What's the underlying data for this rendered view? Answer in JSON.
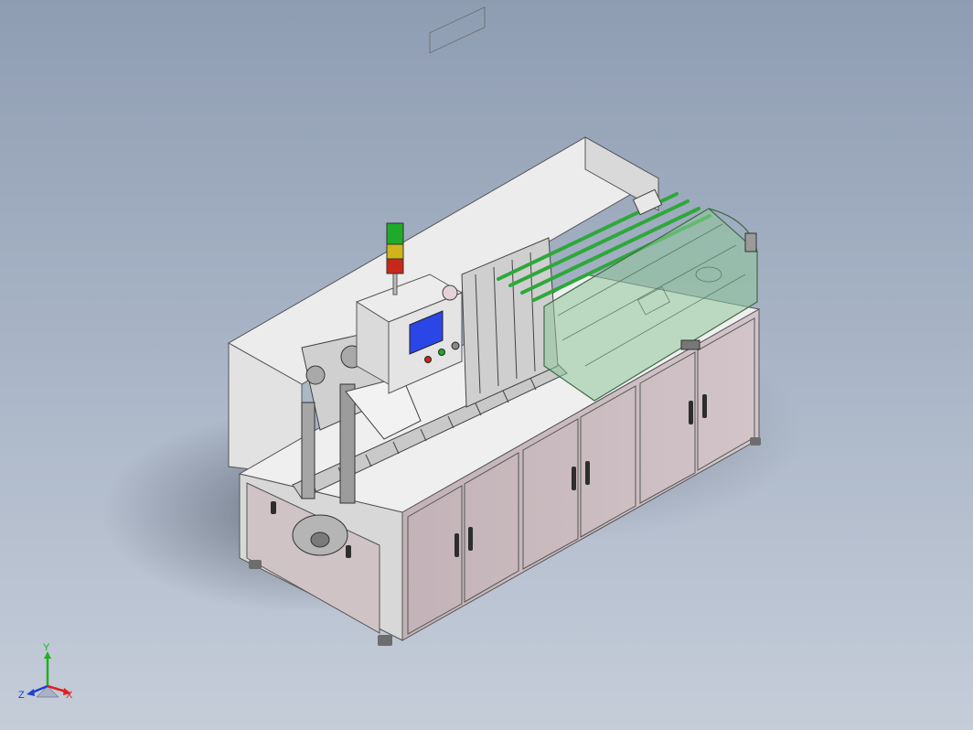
{
  "triad": {
    "x_label": "X",
    "y_label": "Y",
    "z_label": "Z",
    "x_color": "#e02020",
    "y_color": "#20b020",
    "z_color": "#2040d0"
  },
  "model": {
    "cabinet_color": "#cbbcc0",
    "frame_color": "#e7e7e7",
    "guard_color": "#8fc79a",
    "hmi_screen_color": "#2b46e6",
    "beacon_colors": [
      "#1faa2a",
      "#d0b41c",
      "#c8281c"
    ]
  }
}
